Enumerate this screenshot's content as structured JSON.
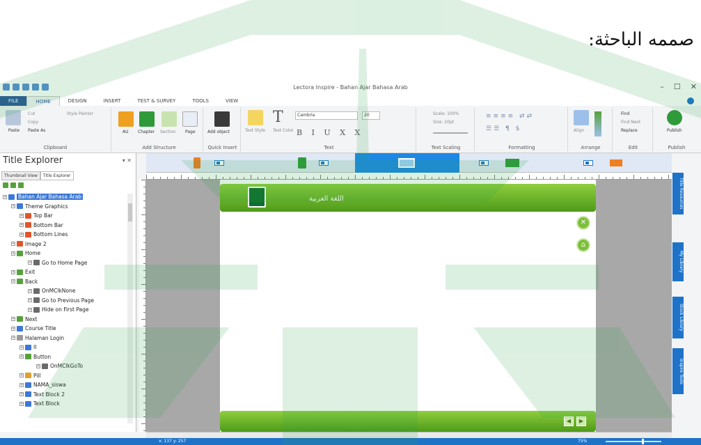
{
  "caption": "صممه الباحثة:",
  "window": {
    "title": "Lectora Inspire - Bahan Ajar Bahasa Arab",
    "controls": [
      "–",
      "☐",
      "✕"
    ]
  },
  "tabs": [
    "FILE",
    "HOME",
    "DESIGN",
    "INSERT",
    "TEST & SURVEY",
    "TOOLS",
    "VIEW"
  ],
  "active_tab": "HOME",
  "ribbon": {
    "clipboard": {
      "items": [
        "Cut",
        "Copy",
        "Paste",
        "Paste As",
        "Style Painter"
      ],
      "label": "Clipboard"
    },
    "add_structure": {
      "items": [
        "AU",
        "Chapter",
        "Section",
        "Page"
      ],
      "label": "Add Structure"
    },
    "quick_insert": {
      "items": [
        "Add object"
      ],
      "label": "Quick Insert"
    },
    "text": {
      "font": "Cambria",
      "size": "20",
      "items": [
        "Text Style",
        "Text Color"
      ],
      "label": "Text"
    },
    "text_scaling": {
      "scale": "Scale: 100%",
      "size": "Size: 20pt",
      "label": "Text Scaling"
    },
    "formatting": {
      "label": "Formatting"
    },
    "arrange": {
      "items": [
        "Align"
      ],
      "label": "Arrange"
    },
    "edit": {
      "items": [
        "Find",
        "Find Next",
        "Replace"
      ],
      "label": "Edit"
    },
    "publish": {
      "items": [
        "Publish"
      ],
      "label": "Publish"
    }
  },
  "left_panel": {
    "title": "Title Explorer",
    "tabs": [
      "Thumbnail View",
      "Title Explorer"
    ],
    "tree": [
      {
        "label": "Bahan Ajar Bahasa Arab",
        "indent": 0,
        "icon": "#3b78d8",
        "selected": true
      },
      {
        "label": "Theme Graphics",
        "indent": 1,
        "icon": "#3b78d8"
      },
      {
        "label": "Top Bar",
        "indent": 2,
        "icon": "#e0552b"
      },
      {
        "label": "Bottom Bar",
        "indent": 2,
        "icon": "#e0552b"
      },
      {
        "label": "Bottom Lines",
        "indent": 2,
        "icon": "#e0552b"
      },
      {
        "label": "Image 2",
        "indent": 1,
        "icon": "#e0552b"
      },
      {
        "label": "Home",
        "indent": 1,
        "icon": "#55a23a"
      },
      {
        "label": "Go to Home Page",
        "indent": 3,
        "icon": "#6a6a6a"
      },
      {
        "label": "Exit",
        "indent": 1,
        "icon": "#55a23a"
      },
      {
        "label": "Back",
        "indent": 1,
        "icon": "#55a23a"
      },
      {
        "label": "OnMClkNone",
        "indent": 3,
        "icon": "#6a6a6a"
      },
      {
        "label": "Go to Previous Page",
        "indent": 3,
        "icon": "#6a6a6a"
      },
      {
        "label": "Hide on First Page",
        "indent": 3,
        "icon": "#6a6a6a"
      },
      {
        "label": "Next",
        "indent": 1,
        "icon": "#55a23a"
      },
      {
        "label": "Course Title",
        "indent": 1,
        "icon": "#3b78d8"
      },
      {
        "label": "Halaman Login",
        "indent": 1,
        "icon": "#999999"
      },
      {
        "label": "II",
        "indent": 2,
        "icon": "#3b78d8"
      },
      {
        "label": "Button",
        "indent": 2,
        "icon": "#55a23a"
      },
      {
        "label": "OnMClkGoTo",
        "indent": 4,
        "icon": "#6a6a6a"
      },
      {
        "label": "Pill",
        "indent": 2,
        "icon": "#e0a12b"
      },
      {
        "label": "NAMA_siswa",
        "indent": 2,
        "icon": "#3b78d8"
      },
      {
        "label": "Text Block 2",
        "indent": 2,
        "icon": "#3b78d8"
      },
      {
        "label": "Text Block",
        "indent": 2,
        "icon": "#3b78d8"
      }
    ]
  },
  "page": {
    "header_text": "اللغة العربية"
  },
  "right_tabs": [
    "Title Resources",
    "My Library",
    "Stock Library",
    "Inspire Tools"
  ],
  "status": {
    "coords": "x: 137 y: 257",
    "zoom": "75%"
  },
  "colors": {
    "accent": "#1e73c9",
    "green": "#55a23a"
  }
}
